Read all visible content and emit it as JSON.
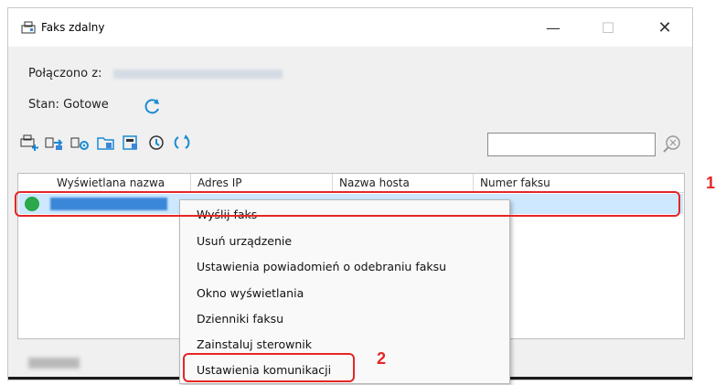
{
  "window": {
    "title": "Faks zdalny",
    "minimize": "—",
    "maximize": "☐",
    "close": "✕"
  },
  "status": {
    "connected_label": "Połączono z:",
    "state_label": "Stan:",
    "state_value": "Gotowe"
  },
  "toolbar": {
    "icons": [
      "add-device-icon",
      "send-fax-icon",
      "settings-icon",
      "folder-icon",
      "fax-device-icon",
      "status-view-icon",
      "refresh-icon"
    ]
  },
  "table": {
    "columns": [
      "Wyświetlana nazwa",
      "Adres IP",
      "Nazwa hosta",
      "Numer faksu"
    ],
    "rows": [
      {
        "status_color": "#2aa84a"
      }
    ]
  },
  "context_menu": {
    "items": [
      "Wyślij faks",
      "Usuń urządzenie",
      "Ustawienia powiadomień o odebraniu faksu",
      "Okno wyświetlania",
      "Dzienniki faksu",
      "Zainstaluj sterownik",
      "Ustawienia komunikacji"
    ]
  },
  "callouts": {
    "one": "1",
    "two": "2"
  },
  "colors": {
    "highlight": "#e52626",
    "selection": "#cde8ff",
    "status_ok": "#2aa84a"
  }
}
